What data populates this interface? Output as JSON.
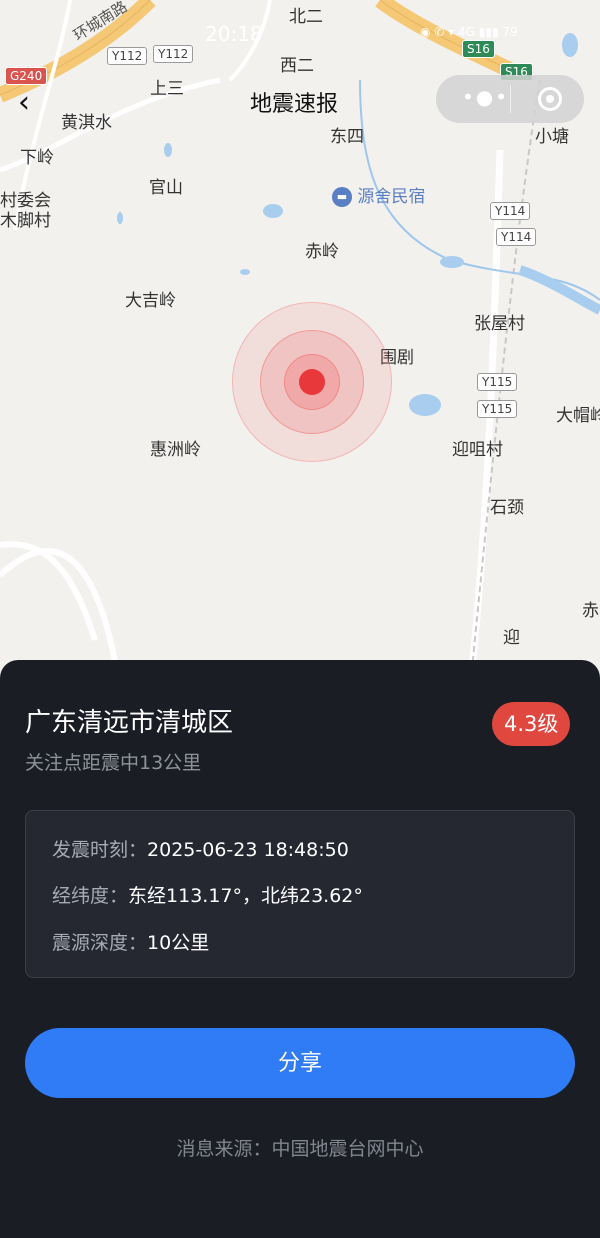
{
  "status_bar": {
    "time": "20:18",
    "icons": "◉ ✆ ▾ 4G ▮▮▮ 79"
  },
  "header": {
    "title": "地震速报",
    "back_icon": "chevron-left-icon",
    "more_icon": "more-dots-icon",
    "close_icon": "target-icon"
  },
  "map": {
    "places": [
      "北二",
      "西二",
      "上三",
      "黄淇水",
      "下岭",
      "村委会",
      "木脚村",
      "官山",
      "东四",
      "小塘",
      "源舍民宿",
      "赤岭",
      "大吉岭",
      "张屋村",
      "围剧",
      "大帽岭",
      "惠洲岭",
      "迎咀村",
      "石颈",
      "赤",
      "迎"
    ],
    "roads": [
      "环城南路",
      "Y112",
      "Y112",
      "G240",
      "S16",
      "S16",
      "Y114",
      "Y114",
      "Y115",
      "Y115"
    ]
  },
  "quake": {
    "location": "广东清远市清城区",
    "distance": "关注点距震中13公里",
    "magnitude": "4.3级",
    "time_label": "发震时刻：",
    "time_value": "2025-06-23 18:48:50",
    "coord_label": "经纬度：",
    "coord_value": "东经113.17°，北纬23.62°",
    "depth_label": "震源深度：",
    "depth_value": "10公里"
  },
  "actions": {
    "share_label": "分享"
  },
  "footer": {
    "source": "消息来源：中国地震台网中心"
  },
  "colors": {
    "accent": "#2f7cf6",
    "magnitude_badge": "#e0473f",
    "epicenter": "#e8383b",
    "panel": "#1b1d24"
  }
}
